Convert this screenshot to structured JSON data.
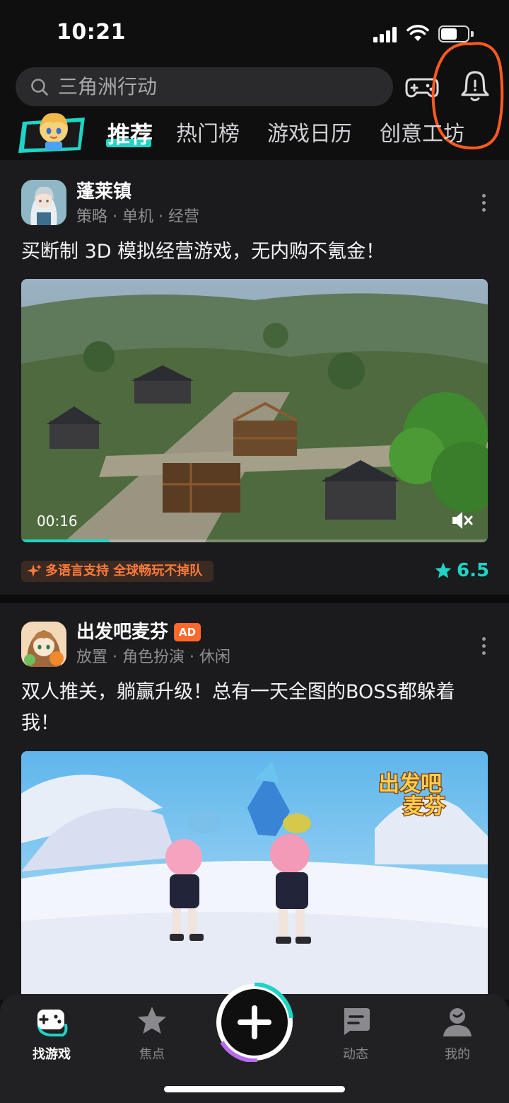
{
  "status_bar": {
    "time": "10:21"
  },
  "header": {
    "search_placeholder": "三角洲行动"
  },
  "tabs": [
    {
      "label": "推荐",
      "active": true
    },
    {
      "label": "热门榜",
      "active": false
    },
    {
      "label": "游戏日历",
      "active": false
    },
    {
      "label": "创意工坊",
      "active": false
    }
  ],
  "feed": [
    {
      "name": "蓬莱镇",
      "tags": "策略 · 单机 · 经营",
      "headline": "买断制 3D 模拟经营游戏，无内购不氪金！",
      "video": {
        "time": "00:16",
        "progress": 0.19,
        "muted": true
      },
      "promo": "多语言支持 全球畅玩不掉队",
      "rating": "6.5"
    },
    {
      "name": "出发吧麦芬",
      "ad_badge": "AD",
      "tags": "放置 · 角色扮演 · 休闲",
      "headline": "双人推关，躺赢升级！总有一天全图的BOSS都躲着我！",
      "banner_logo": "出发吧麦芬"
    }
  ],
  "bottom_nav": [
    {
      "label": "找游戏",
      "icon": "gamepad-icon",
      "active": true
    },
    {
      "label": "焦点",
      "icon": "star-icon",
      "active": false
    },
    {
      "label": "",
      "icon": "plus-icon",
      "active": false
    },
    {
      "label": "动态",
      "icon": "chat-card-icon",
      "active": false
    },
    {
      "label": "我的",
      "icon": "user-icon",
      "active": false
    }
  ],
  "colors": {
    "accent": "#1fd4c4",
    "ad": "#ff6a2c",
    "promo": "#ff7a3c",
    "annotation": "#ff5a1f",
    "background": "#1b1b1d"
  }
}
